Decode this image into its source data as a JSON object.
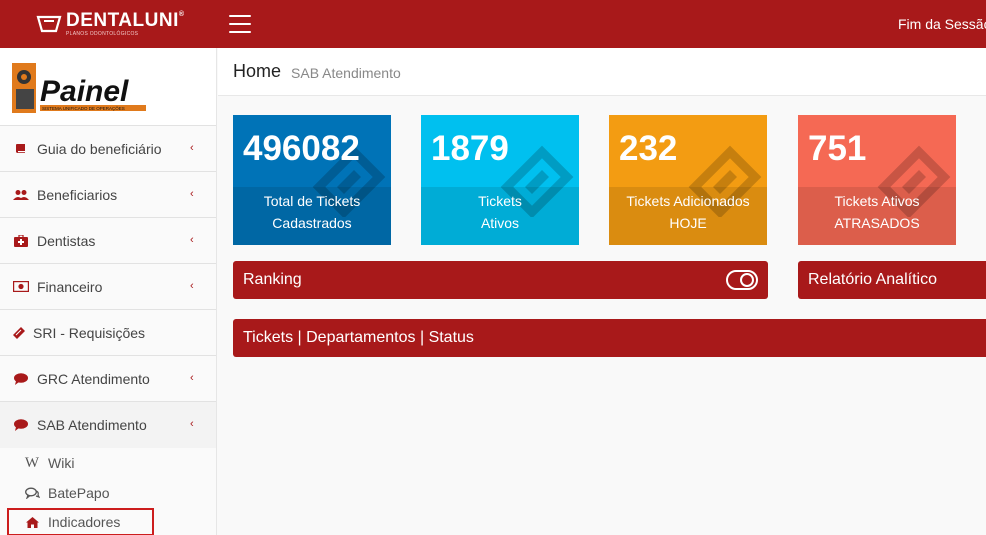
{
  "header": {
    "logo_text": "DENTALUNI",
    "logo_reg": "®",
    "logo_sub": "PLANOS ODONTOLÓGICOS",
    "session_label": "Fim da Sessão"
  },
  "sidebar": {
    "brand_text": "Painel",
    "brand_sub": "SISTEMA UNIFICADO DE OPERAÇÕES",
    "items": [
      {
        "label": "Guia do beneficiário",
        "icon": "book-icon",
        "has_chevron": true
      },
      {
        "label": "Beneficiarios",
        "icon": "users-icon",
        "has_chevron": true
      },
      {
        "label": "Dentistas",
        "icon": "medkit-icon",
        "has_chevron": true
      },
      {
        "label": "Financeiro",
        "icon": "money-icon",
        "has_chevron": true
      },
      {
        "label": "SRI - Requisições",
        "icon": "ticket-icon",
        "has_chevron": false
      },
      {
        "label": "GRC Atendimento",
        "icon": "comment-icon",
        "has_chevron": true
      },
      {
        "label": "SAB Atendimento",
        "icon": "comment-icon",
        "has_chevron": true
      }
    ],
    "subitems": [
      {
        "label": "Wiki",
        "icon": "wikipedia-icon"
      },
      {
        "label": "BatePapo",
        "icon": "chat-icon"
      },
      {
        "label": "Indicadores",
        "icon": "home-icon"
      }
    ],
    "chevron": "‹"
  },
  "breadcrumb": {
    "title": "Home",
    "subtitle": "SAB Atendimento"
  },
  "cards": [
    {
      "value": "496082",
      "label_line1": "Total de Tickets",
      "label_line2": "Cadastrados",
      "color": "#0073b7"
    },
    {
      "value": "1879",
      "label_line1": "Tickets",
      "label_line2": "Ativos",
      "color": "#00c0ef"
    },
    {
      "value": "232",
      "label_line1": "Tickets Adicionados",
      "label_line2": "HOJE",
      "color": "#f39c12"
    },
    {
      "value": "751",
      "label_line1": "Tickets Ativos",
      "label_line2": "ATRASADOS",
      "color": "#f56954"
    }
  ],
  "panels": {
    "ranking": "Ranking",
    "relatorio": "Relatório Analítico",
    "tickets": "Tickets | Departamentos | Status"
  },
  "colors": {
    "brand_red": "#a8191a",
    "active_outline": "#cc1d1d"
  }
}
